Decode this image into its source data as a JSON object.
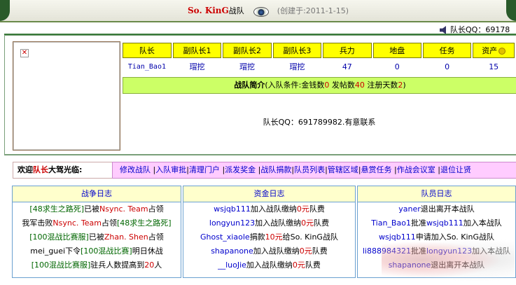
{
  "header": {
    "team_name": "So. KinG",
    "team_suffix": "战队",
    "created": "(创建于:2011-1-15)",
    "qq_label": "队长QQ：69178"
  },
  "stats": {
    "headers": [
      "队长",
      "副队长1",
      "副队长2",
      "副队长3",
      "兵力",
      "地盘",
      "任务",
      "资产"
    ],
    "values": [
      "Tian_Bao1",
      "瑁挖",
      "瑁挖",
      "瑁挖",
      "47",
      "0",
      "0",
      "15"
    ]
  },
  "intro": {
    "title": "战队简介",
    "cond_prefix": "(入队条件:金钱数",
    "money": "0",
    "posts_label": " 发帖数",
    "posts": "40",
    "days_label": " 注册天数",
    "days": "2",
    "cond_suffix": ")",
    "body": "队长QQ：691789982.有意联系"
  },
  "nav": {
    "welcome_prefix": "欢迎",
    "welcome_role": "队长",
    "welcome_suffix": "大驾光临:",
    "links": [
      "修改战队",
      "入队审批",
      "清理门户",
      "派发奖金",
      "战队捐款",
      "队员列表",
      "管辖区域",
      "悬赏任务",
      "作战会议室",
      "退位让贤"
    ]
  },
  "logs": {
    "war": {
      "title": "战争日志",
      "rows": [
        {
          "a": "[48求生之路死]",
          "b": "已被",
          "c": "Nsync. Team",
          "d": "占领"
        },
        {
          "a": "我军击败",
          "b": "Nsync. Team",
          "c": "占领",
          "d": "[48求生之路死]"
        },
        {
          "a": "[100混战比赛服]",
          "b": "已被",
          "c": "Zhan. Shen",
          "d": "占领"
        },
        {
          "a": "mei_guei",
          "b": "下令",
          "c": "[100混战比赛]",
          "d": "明日休战"
        },
        {
          "a": "[100混战比赛服]",
          "b": "驻兵人数提高到",
          "c": "20",
          "d": "人"
        }
      ]
    },
    "fund": {
      "title": "资金日志",
      "rows": [
        {
          "a": "wsjqb111",
          "b": "加入战队缴纳",
          "c": "0元",
          "d": "队费"
        },
        {
          "a": "longyun123",
          "b": "加入战队缴纳",
          "c": "0元",
          "d": "队费"
        },
        {
          "a": "Ghost_xiaole",
          "b": "捐款",
          "c": "10元",
          "d": "给So. KinG战队"
        },
        {
          "a": "shapanone",
          "b": "加入战队缴纳",
          "c": "0元",
          "d": "队费"
        },
        {
          "a": "__luoJie",
          "b": "加入战队缴纳",
          "c": "0元",
          "d": "队费"
        }
      ]
    },
    "member": {
      "title": "队员日志",
      "rows": [
        {
          "a": "yaner",
          "b": "退出离开本战队",
          "c": "",
          "d": ""
        },
        {
          "a": "Tian_Bao1",
          "b": "批准",
          "c": "wsjqb111",
          "d": "加入本战队"
        },
        {
          "a": "wsjqb111",
          "b": "申请加入So. KinG战队",
          "c": "",
          "d": ""
        },
        {
          "a": "li888984321",
          "b": "批准",
          "c": "longyun123",
          "d": "加入本战队"
        },
        {
          "a": "shapanone",
          "b": "退出离开本战队",
          "c": "",
          "d": ""
        }
      ]
    }
  }
}
